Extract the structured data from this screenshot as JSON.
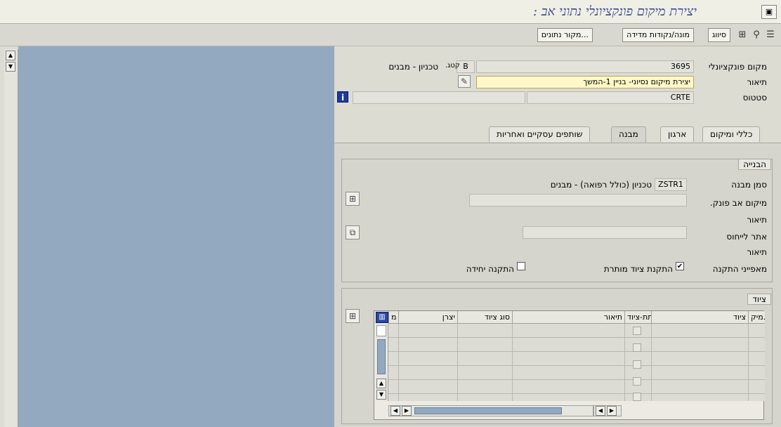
{
  "window": {
    "title": "יצירת מיקום פונקציונלי נתוני אב :",
    "title_color": "#3d4a8e"
  },
  "toolbar": {
    "buttons": [
      "סיווג",
      "מונה/נקודות מדידה",
      "מקור נתונים..."
    ]
  },
  "header": {
    "functional_location_label": "מקום פונקציונלי",
    "functional_location_value": "3695",
    "category_label": "קטג.",
    "category_code": "B",
    "category_text": "טכניון - מבנים",
    "description_label": "תיאור",
    "description_value": "יצירת מיקום נסיוני- בניין 1-המשך",
    "status_label": "סטטוס",
    "status_value": "CRTE"
  },
  "tabs": [
    "כללי ומיקום",
    "ארגון",
    "מבנה",
    "שותפים עסקיים ואחריות"
  ],
  "active_tab": "מבנה",
  "structure_group": {
    "title": "הבנייה",
    "structure_indicator_label": "סמן מבנה",
    "structure_indicator_value": "ZSTR1",
    "structure_indicator_text": "טכניון (כולל רפואה) - מבנים",
    "superior_location_label": "מיקום אב פונק.",
    "description_label_1": "תיאור",
    "reference_location_label": "אתר לייחוס",
    "description_label_2": "תיאור",
    "installation_label": "מאפייני התקנה",
    "equipment_installation_allowed": "התקנת ציוד מותרת",
    "equipment_installation_checked": "✔",
    "single_installation": "התקנה יחידה"
  },
  "equipment_group": {
    "title": "ציוד",
    "columns": [
      "מיק.",
      "ציוד",
      "תת-ציוד",
      "תיאור",
      "סוג ציוד",
      "יצרן",
      "מ"
    ]
  }
}
